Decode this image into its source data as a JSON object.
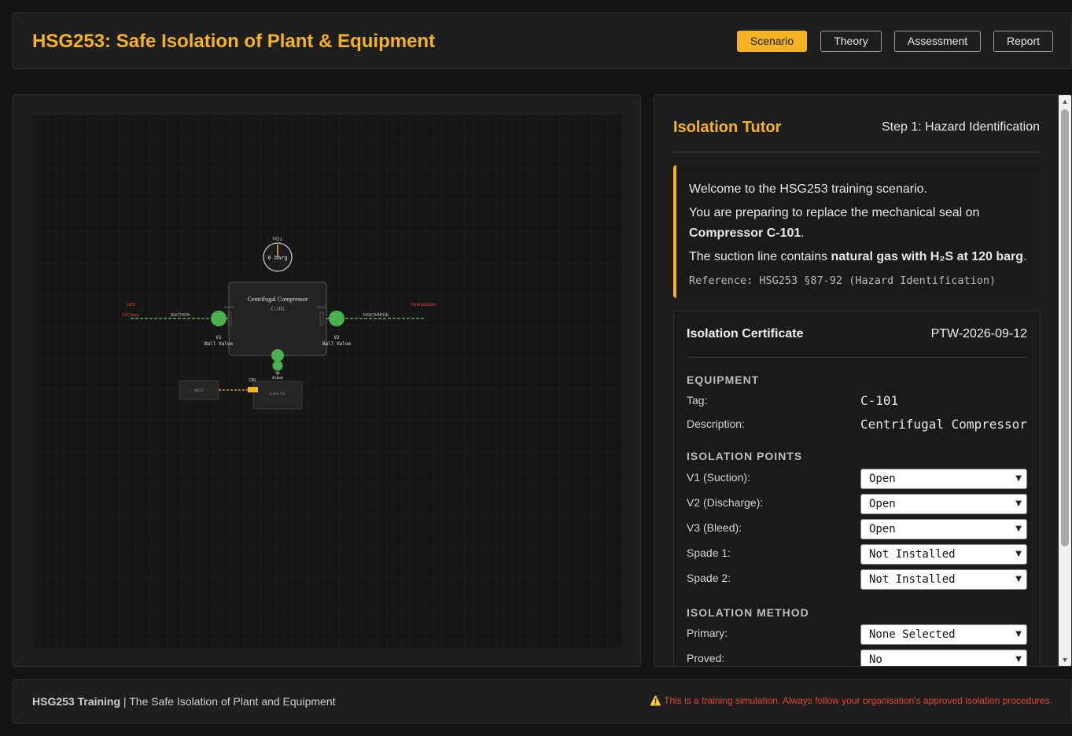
{
  "header": {
    "title": "HSG253: Safe Isolation of Plant & Equipment",
    "nav": [
      "Scenario",
      "Theory",
      "Assessment",
      "Report"
    ],
    "active_nav": "Scenario"
  },
  "diagram": {
    "gauge_label": "PG1",
    "gauge_value": "0 barg",
    "compressor_name": "Centrifugal Compressor",
    "compressor_tag": "C-101",
    "suction_label": "SUCTION",
    "discharge_label": "DISCHARGE",
    "h2s_label": "H2S",
    "pressure_label": "120 barg",
    "hydrocarbon_label": "Hydrocarbon",
    "v1_label": "V1",
    "v1_type": "Ball Valve",
    "v2_label": "V2",
    "v2_type": "Ball Valve",
    "v3_label": "V3",
    "v3_type": "Bleed",
    "spade1_label": "Spade",
    "spade2_label": "Spade",
    "mcc_label": "MCC",
    "cb_label": "CB1",
    "lube_label": "Lube Oil"
  },
  "tutor": {
    "title": "Isolation Tutor",
    "step": "Step 1: Hazard Identification",
    "welcome": "Welcome to the HSG253 training scenario.",
    "line2_prefix": "You are preparing to replace the mechanical seal on ",
    "line2_bold": "Compressor C-101",
    "line2_suffix": ".",
    "line3_prefix": "The suction line contains ",
    "line3_bold": "natural gas with H₂S at 120 barg",
    "line3_suffix": ".",
    "reference": "Reference: HSG253 §87-92 (Hazard Identification)"
  },
  "certificate": {
    "title": "Isolation Certificate",
    "permit_id": "PTW-2026-09-12",
    "equipment_heading": "EQUIPMENT",
    "tag_label": "Tag:",
    "tag_value": "C-101",
    "description_label": "Description:",
    "description_value": "Centrifugal Compressor",
    "isolation_points_heading": "ISOLATION POINTS",
    "v1_label": "V1 (Suction):",
    "v1_value": "Open",
    "v2_label": "V2 (Discharge):",
    "v2_value": "Open",
    "v3_label": "V3 (Bleed):",
    "v3_value": "Open",
    "spade1_label": "Spade 1:",
    "spade1_value": "Not Installed",
    "spade2_label": "Spade 2:",
    "spade2_value": "Not Installed",
    "method_heading": "ISOLATION METHOD",
    "primary_label": "Primary:",
    "primary_value": "None Selected",
    "proved_label": "Proved:",
    "proved_value": "No"
  },
  "footer": {
    "brand": "HSG253 Training",
    "subtitle": " | The Safe Isolation of Plant and Equipment",
    "warning_icon": "⚠️",
    "warning": "This is a training simulation. Always follow your organisation's approved isolation procedures."
  },
  "colors": {
    "accent": "#f5b324",
    "valve_green": "#4caf50",
    "hazard_red": "#e3452f"
  }
}
